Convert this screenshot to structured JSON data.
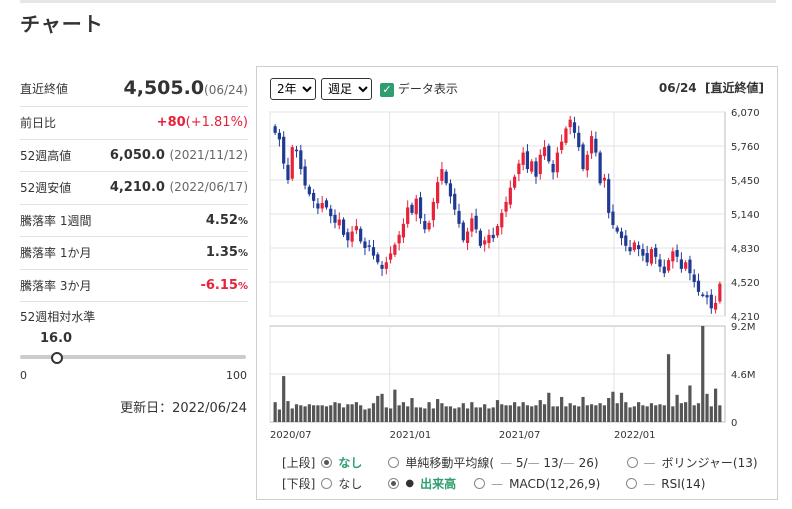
{
  "page_title": "チャート",
  "stats": {
    "close": {
      "label": "直近終値",
      "value": "4,505.0",
      "date": "(06/24)"
    },
    "change": {
      "label": "前日比",
      "value": "+80",
      "pct": "(+1.81%)"
    },
    "high52": {
      "label": "52週高値",
      "value": "6,050.0",
      "date": "(2021/11/12)"
    },
    "low52": {
      "label": "52週安値",
      "value": "4,210.0",
      "date": "(2022/06/17)"
    },
    "r1w": {
      "label": "騰落率 1週間",
      "value": "4.52",
      "unit": "%"
    },
    "r1m": {
      "label": "騰落率 1か月",
      "value": "1.35",
      "unit": "%"
    },
    "r3m": {
      "label": "騰落率 3か月",
      "value": "-6.15",
      "unit": "%"
    }
  },
  "level": {
    "label": "52週相対水準",
    "value": "16.0",
    "min": "0",
    "max": "100",
    "fraction": 0.16
  },
  "updated": "更新日：2022/06/24",
  "controls": {
    "period": "2年",
    "interval": "週足",
    "data_toggle": "データ表示",
    "header_date": "06/24",
    "header_label": "[直近終値]"
  },
  "legend": {
    "upper_label": "[上段]",
    "lower_label": "[下段]",
    "none": "なし",
    "sma": "単純移動平均線(",
    "sma_5": "5/",
    "sma_13": "13/",
    "sma_26": "26)",
    "bollinger": "ボリンジャー(13)",
    "volume": "出来高",
    "macd": "MACD(12,26,9)",
    "rsi": "RSI(14)"
  },
  "colors": {
    "up": "#e5233b",
    "down": "#1f3a93",
    "accent": "#2e9e6e"
  },
  "chart_data": {
    "type": "candlestick",
    "price_ticks": [
      "6,070",
      "5,760",
      "5,450",
      "5,140",
      "4,830",
      "4,520",
      "4,210"
    ],
    "ylim": [
      4210,
      6070
    ],
    "volume_ticks": [
      "9.2M",
      "4.6M",
      "0"
    ],
    "volume_ylim": [
      0,
      9.2
    ],
    "x_ticks": [
      "2020/07",
      "2021/01",
      "2021/07",
      "2022/01"
    ],
    "series_close": [
      5880,
      5820,
      5600,
      5450,
      5750,
      5720,
      5550,
      5400,
      5320,
      5260,
      5190,
      5240,
      5200,
      5120,
      5060,
      5090,
      4950,
      4900,
      4980,
      5030,
      4890,
      4830,
      4850,
      4760,
      4700,
      4640,
      4700,
      4780,
      4860,
      4950,
      5050,
      5200,
      5150,
      5280,
      5100,
      5000,
      5060,
      5250,
      5430,
      5550,
      5420,
      5300,
      5180,
      5050,
      4900,
      4980,
      5100,
      5000,
      4850,
      4900,
      4950,
      4920,
      5030,
      5150,
      5250,
      5380,
      5480,
      5600,
      5700,
      5550,
      5620,
      5480,
      5680,
      5750,
      5620,
      5520,
      5700,
      5800,
      5920,
      6000,
      5880,
      5750,
      5550,
      5680,
      5850,
      5700,
      5420,
      5470,
      5150,
      5040,
      4980,
      4920,
      4850,
      4800,
      4880,
      4820,
      4760,
      4700,
      4820,
      4750,
      4660,
      4600,
      4720,
      4800,
      4750,
      4640,
      4700,
      4600,
      4520,
      4430,
      4400,
      4380,
      4280,
      4330,
      4505
    ],
    "volumes": [
      1.9,
      1.2,
      4.4,
      2.0,
      1.3,
      1.7,
      1.6,
      1.5,
      1.7,
      1.6,
      1.6,
      1.6,
      1.5,
      1.6,
      1.9,
      1.8,
      1.4,
      1.7,
      1.7,
      1.9,
      1.6,
      1.2,
      1.3,
      1.8,
      2.5,
      2.7,
      1.4,
      1.3,
      3.1,
      1.6,
      1.9,
      1.5,
      2.3,
      1.4,
      1.4,
      1.3,
      1.9,
      1.3,
      2.2,
      1.8,
      1.5,
      1.5,
      1.3,
      1.4,
      1.8,
      1.3,
      1.9,
      1.4,
      1.4,
      1.7,
      1.3,
      1.4,
      2.1,
      1.7,
      1.6,
      1.6,
      1.9,
      1.5,
      1.9,
      1.6,
      1.5,
      1.6,
      2.1,
      1.7,
      2.8,
      1.5,
      1.5,
      2.4,
      1.5,
      1.8,
      1.6,
      1.5,
      2.4,
      1.6,
      1.7,
      1.6,
      1.8,
      1.6,
      2.3,
      2.9,
      1.8,
      2.8,
      1.9,
      1.4,
      1.5,
      1.9,
      1.6,
      1.5,
      1.8,
      1.6,
      1.7,
      1.6,
      6.5,
      1.5,
      2.6,
      1.8,
      1.9,
      3.5,
      1.6,
      1.8,
      9.2,
      2.7,
      1.5,
      3.2,
      1.6
    ]
  }
}
